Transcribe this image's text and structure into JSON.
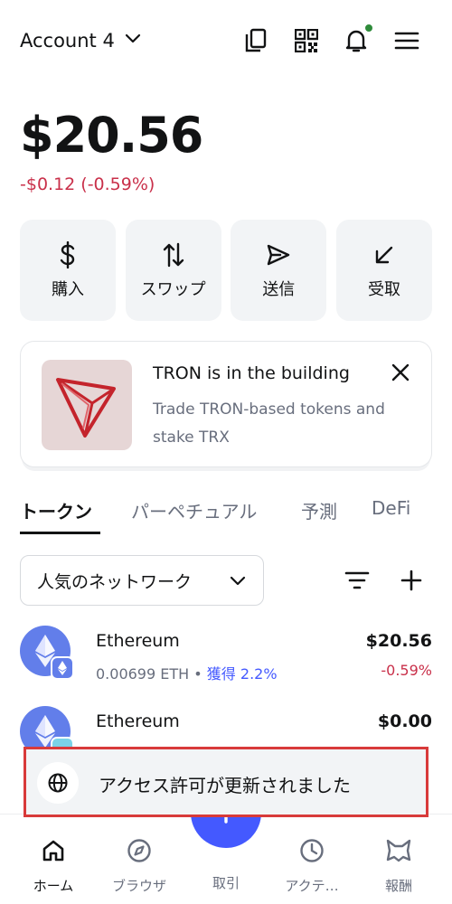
{
  "header": {
    "account_name": "Account 4",
    "icons": [
      "copy-icon",
      "qr-code-icon",
      "bell-icon",
      "menu-icon"
    ]
  },
  "balance": {
    "total": "$20.56",
    "change": "-$0.12 (-0.59%)"
  },
  "actions": [
    {
      "label": "購入",
      "icon": "dollar-icon"
    },
    {
      "label": "スワップ",
      "icon": "swap-icon"
    },
    {
      "label": "送信",
      "icon": "send-icon"
    },
    {
      "label": "受取",
      "icon": "receive-icon"
    }
  ],
  "banner": {
    "title": "TRON is in the building",
    "description": "Trade TRON-based tokens and stake TRX"
  },
  "tabs": [
    {
      "label": "トークン",
      "active": true
    },
    {
      "label": "パーペチュアル",
      "active": false
    },
    {
      "label": "予測",
      "active": false
    },
    {
      "label": "DeFi",
      "active": false
    }
  ],
  "network_filter": {
    "selected": "人気のネットワーク"
  },
  "tokens": [
    {
      "name": "Ethereum",
      "amount": "0.00699 ETH",
      "earn": "獲得 2.2%",
      "value": "$20.56",
      "change": "-0.59%"
    },
    {
      "name": "Ethereum",
      "amount": "",
      "earn": "",
      "value": "$0.00",
      "change": ""
    }
  ],
  "toast": {
    "message": "アクセス許可が更新されました"
  },
  "bottom_nav": [
    {
      "label": "ホーム",
      "icon": "home-icon",
      "active": true
    },
    {
      "label": "ブラウザ",
      "icon": "compass-icon",
      "active": false
    },
    {
      "label": "取引",
      "icon": "plus-icon",
      "active": false
    },
    {
      "label": "アクテ…",
      "icon": "clock-icon",
      "active": false
    },
    {
      "label": "報酬",
      "icon": "fox-icon",
      "active": false
    }
  ],
  "colors": {
    "accent": "#4459ff",
    "negative": "#c9304a",
    "toast_highlight": "#d83a3a",
    "notification_dot": "#2e8b3a"
  }
}
